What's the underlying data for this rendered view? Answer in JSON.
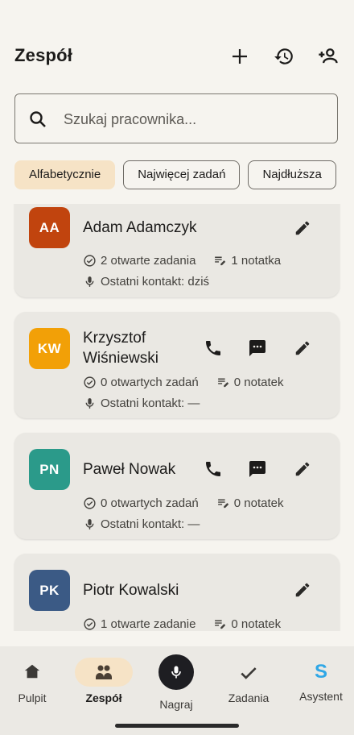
{
  "header": {
    "title": "Zespół"
  },
  "search": {
    "placeholder": "Szukaj pracownika..."
  },
  "filters": [
    {
      "label": "Alfabetycznie",
      "active": true
    },
    {
      "label": "Najwięcej zadań",
      "active": false
    },
    {
      "label": "Najdłuższa",
      "active": false
    }
  ],
  "employees": [
    {
      "initials": "AA",
      "name": "Adam Adamczyk",
      "color": "#c1440e",
      "tasks": "2 otwarte zadania",
      "notes": "1 notatka",
      "contact": "Ostatni kontakt: dziś"
    },
    {
      "initials": "KW",
      "name": "Krzysztof Wiśniewski",
      "color": "#f2a007",
      "tasks": "0 otwartych zadań",
      "notes": "0 notatek",
      "contact": "Ostatni kontakt: —"
    },
    {
      "initials": "PN",
      "name": "Paweł Nowak",
      "color": "#2b9a8a",
      "tasks": "0 otwartych zadań",
      "notes": "0 notatek",
      "contact": "Ostatni kontakt: —"
    },
    {
      "initials": "PK",
      "name": "Piotr Kowalski",
      "color": "#3b5a85",
      "tasks": "1 otwarte zadanie",
      "notes": "0 notatek",
      "contact": ""
    }
  ],
  "nav": [
    {
      "label": "Pulpit",
      "icon": "home-icon"
    },
    {
      "label": "Zespół",
      "icon": "team-icon",
      "active": true
    },
    {
      "label": "Nagraj",
      "icon": "mic-icon"
    },
    {
      "label": "Zadania",
      "icon": "check-icon"
    },
    {
      "label": "Asystent",
      "icon": "assistant-s-icon"
    }
  ],
  "assistant_glyph": "S"
}
